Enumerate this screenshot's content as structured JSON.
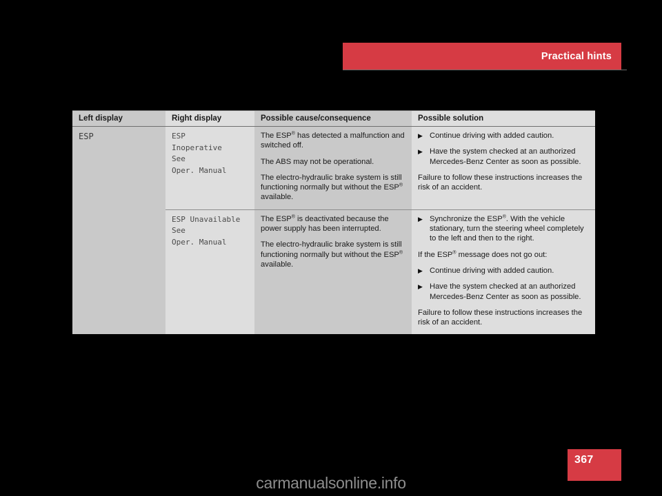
{
  "header": {
    "title": "Practical hints",
    "band_color": "#d63b44"
  },
  "page": {
    "number": "367",
    "badge_color": "#d63b44"
  },
  "watermark": {
    "text": "carmanualsonline.info"
  },
  "table": {
    "columns": [
      {
        "label": "Left display",
        "bg": "#c9c9c9"
      },
      {
        "label": "Right display",
        "bg": "#dedede"
      },
      {
        "label": "Possible cause/consequence",
        "bg": "#c9c9c9"
      },
      {
        "label": "Possible solution",
        "bg": "#dedede"
      }
    ],
    "left_display": "ESP",
    "rows": [
      {
        "right_display": "ESP\nInoperative\nSee\nOper. Manual",
        "cause": {
          "paragraphs": [
            {
              "before": "The ESP",
              "reg": "®",
              "after": " has detected a malfunction and switched off."
            },
            {
              "before": "The ABS may not be operational.",
              "reg": "",
              "after": ""
            },
            {
              "before": "The electro-hydraulic brake system is still functioning normally but without the ESP",
              "reg": "®",
              "after": " available."
            }
          ]
        },
        "solution": {
          "blocks": [
            {
              "kind": "bullet",
              "mark": "▶",
              "before": "Continue driving with added caution.",
              "reg": "",
              "after": ""
            },
            {
              "kind": "bullet",
              "mark": "▶",
              "before": "Have the system checked at an authorized Mercedes-Benz Center as soon as possible.",
              "reg": "",
              "after": ""
            },
            {
              "kind": "para",
              "mark": "",
              "before": "Failure to follow these instructions increases the risk of an accident.",
              "reg": "",
              "after": ""
            }
          ]
        }
      },
      {
        "right_display": "ESP Unavailable\nSee\nOper. Manual",
        "cause": {
          "paragraphs": [
            {
              "before": "The ESP",
              "reg": "®",
              "after": " is deactivated because the power supply has been interrupted."
            },
            {
              "before": "The electro-hydraulic brake system is still functioning normally but without the ESP",
              "reg": "®",
              "after": " available."
            }
          ]
        },
        "solution": {
          "blocks": [
            {
              "kind": "bullet",
              "mark": "▶",
              "before": "Synchronize the ESP",
              "reg": "®",
              "after": ". With the vehicle stationary, turn the steering wheel completely to the left and then to the right."
            },
            {
              "kind": "para",
              "mark": "",
              "before": "If the ESP",
              "reg": "®",
              "after": " message does not go out:"
            },
            {
              "kind": "bullet",
              "mark": "▶",
              "before": "Continue driving with added caution.",
              "reg": "",
              "after": ""
            },
            {
              "kind": "bullet",
              "mark": "▶",
              "before": "Have the system checked at an authorized Mercedes-Benz Center as soon as possible.",
              "reg": "",
              "after": ""
            },
            {
              "kind": "para",
              "mark": "",
              "before": "Failure to follow these instructions increases the risk of an accident.",
              "reg": "",
              "after": ""
            }
          ]
        }
      }
    ]
  }
}
